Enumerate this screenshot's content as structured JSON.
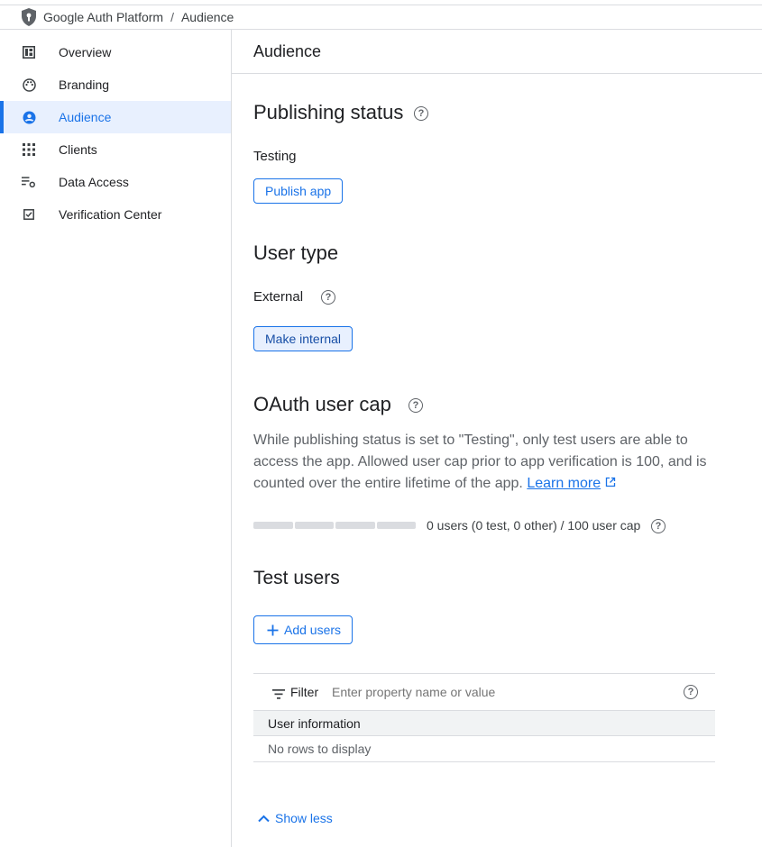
{
  "breadcrumb": {
    "platform": "Google Auth Platform",
    "separator": "/",
    "current": "Audience"
  },
  "sidebar": {
    "items": [
      {
        "label": "Overview",
        "icon": "dashboard-icon",
        "active": false
      },
      {
        "label": "Branding",
        "icon": "palette-icon",
        "active": false
      },
      {
        "label": "Audience",
        "icon": "account-circle-icon",
        "active": true
      },
      {
        "label": "Clients",
        "icon": "apps-grid-icon",
        "active": false
      },
      {
        "label": "Data Access",
        "icon": "list-settings-icon",
        "active": false
      },
      {
        "label": "Verification Center",
        "icon": "checkbox-icon",
        "active": false
      }
    ]
  },
  "main": {
    "title": "Audience",
    "publishing": {
      "heading": "Publishing status",
      "status": "Testing",
      "button": "Publish app"
    },
    "user_type": {
      "heading": "User type",
      "value": "External",
      "button": "Make internal"
    },
    "oauth_cap": {
      "heading": "OAuth user cap",
      "description": "While publishing status is set to \"Testing\", only test users are able to access the app. Allowed user cap prior to app verification is 100, and is counted over the entire lifetime of the app.",
      "learn_more": "Learn more",
      "cap_text": "0 users (0 test, 0 other) / 100 user cap",
      "used_fraction": 0
    },
    "test_users": {
      "heading": "Test users",
      "add_button": "Add users",
      "filter_label": "Filter",
      "filter_placeholder": "Enter property name or value",
      "column_header": "User information",
      "empty_message": "No rows to display"
    },
    "show_less": "Show less"
  },
  "colors": {
    "accent": "#1a73e8",
    "active_bg": "#e8f0fe",
    "border": "#dadce0",
    "muted_text": "#5f6368"
  }
}
